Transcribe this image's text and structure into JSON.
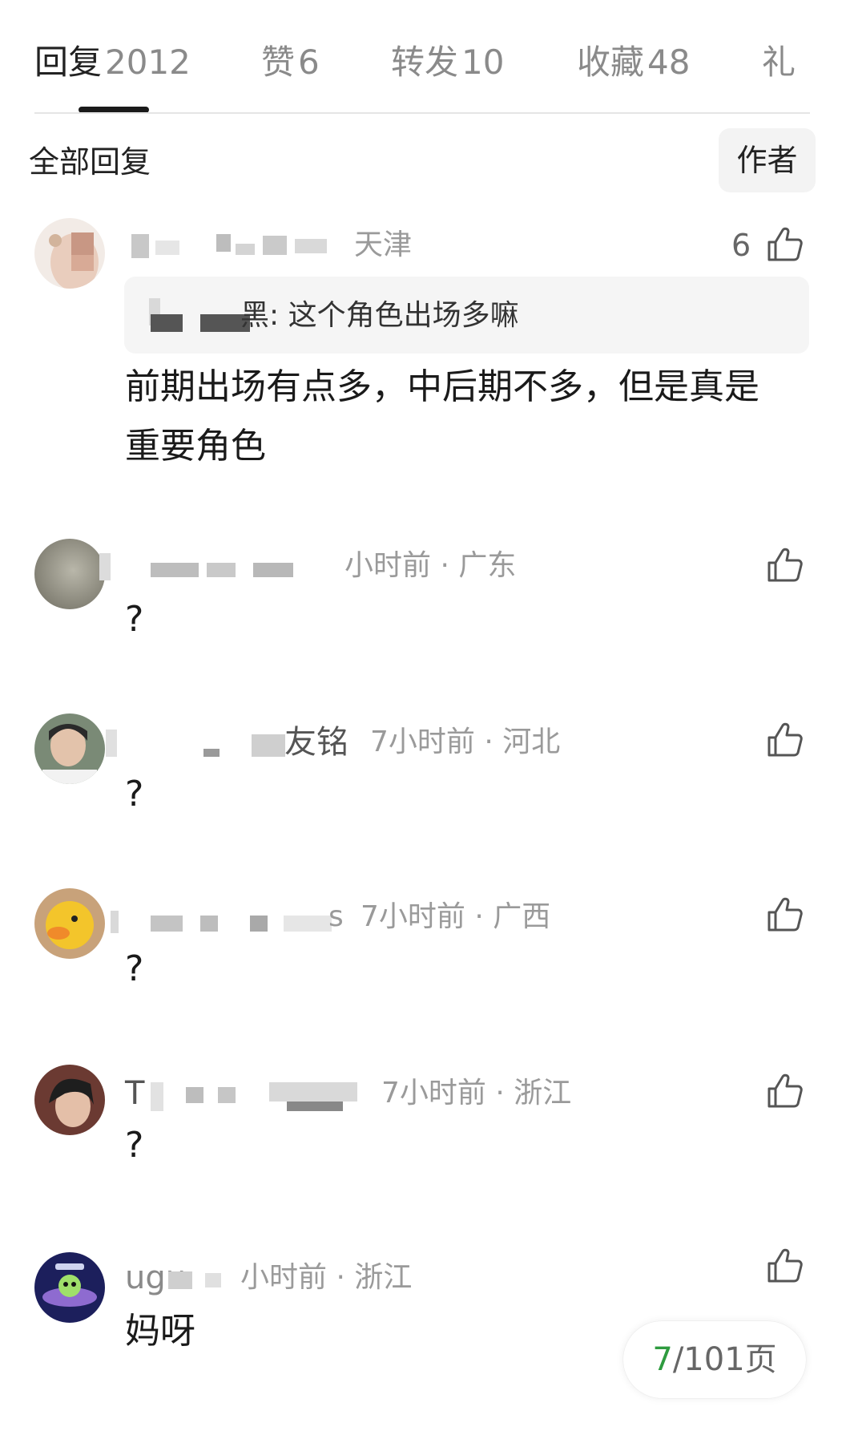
{
  "tabs": [
    {
      "label": "回复",
      "count": "2012",
      "active": true
    },
    {
      "label": "赞",
      "count": "6",
      "active": false
    },
    {
      "label": "转发",
      "count": "10",
      "active": false
    },
    {
      "label": "收藏",
      "count": "48",
      "active": false
    },
    {
      "label": "礼",
      "count": "",
      "active": false
    }
  ],
  "filter": {
    "all_replies_label": "全部回复",
    "author_button_label": "作者"
  },
  "comments": [
    {
      "meta": "天津",
      "like_count": "6",
      "quote": "黑: 这个角色出场多嘛",
      "content_line1": "前期出场有点多，中后期不多，但是真是",
      "content_line2": "重要角色"
    },
    {
      "meta": "小时前 · 广东",
      "content": "?"
    },
    {
      "name_tail": "友铭",
      "meta": "7小时前 · 河北",
      "content": "?"
    },
    {
      "name_tail": "s",
      "meta": "7小时前 · 广西",
      "content": "?"
    },
    {
      "name_head": "T",
      "meta": "7小时前 · 浙江",
      "content": "?"
    },
    {
      "name_head": "ugu",
      "meta": "小时前 · 浙江",
      "content": "妈呀"
    }
  ],
  "pagination": {
    "current": "7",
    "total_text": "/101页"
  },
  "colors": {
    "accent_green": "#2e9b3f",
    "muted_text": "#9a9a9a"
  }
}
